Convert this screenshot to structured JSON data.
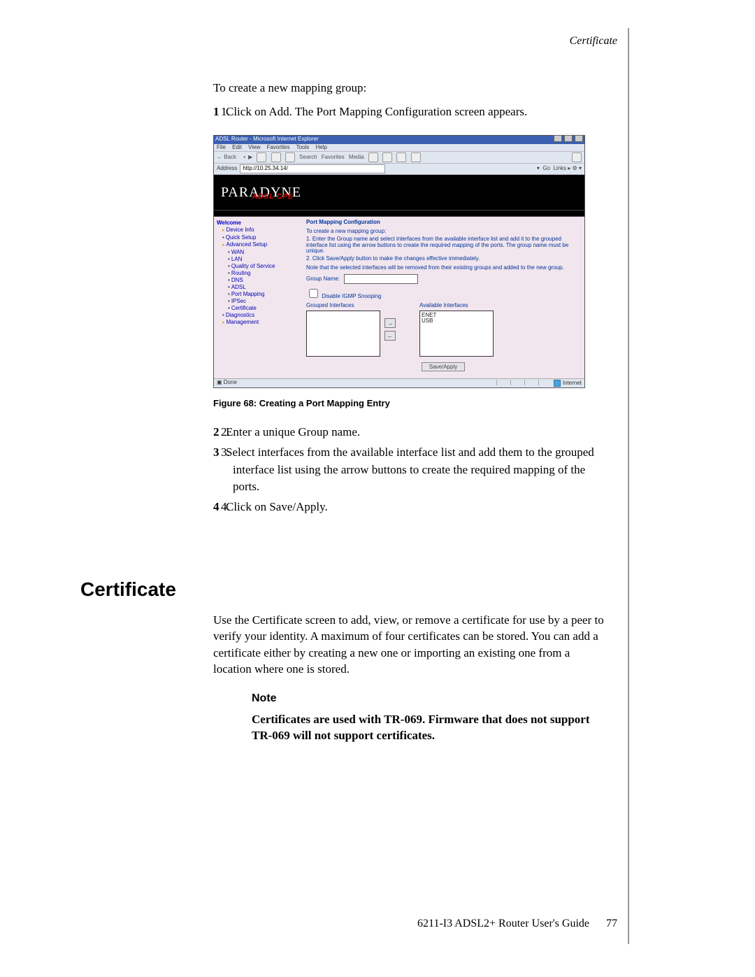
{
  "header": {
    "breadcrumb": "Certificate"
  },
  "intro": "To create a new mapping group:",
  "step1": "Click on Add. The Port Mapping Configuration screen appears.",
  "figure": {
    "caption": "Figure 68: Creating a Port Mapping Entry",
    "window_title": "ADSL Router - Microsoft Internet Explorer",
    "menu": {
      "file": "File",
      "edit": "Edit",
      "view": "View",
      "fav": "Favorites",
      "tools": "Tools",
      "help": "Help"
    },
    "toolbar": {
      "back": "Back",
      "search": "Search",
      "favorites": "Favorites",
      "media": "Media"
    },
    "address_label": "Address",
    "url": "http://10.25.34.14/",
    "go": "Go",
    "links": "Links",
    "brand": "PARADYNE",
    "brand_sub": "ADSL CPE",
    "sidebar": {
      "root": "Welcome",
      "device_info": "Device Info",
      "quick_setup": "Quick Setup",
      "advanced": "Advanced Setup",
      "wan": "WAN",
      "lan": "LAN",
      "qos": "Quality of Service",
      "routing": "Routing",
      "dns": "DNS",
      "adsl": "ADSL",
      "port_mapping": "Port Mapping",
      "ipsec": "IPSec",
      "certificate": "Certificate",
      "diagnostics": "Diagnostics",
      "management": "Management"
    },
    "panel": {
      "title": "Port Mapping Configuration",
      "pre": "To create a new mapping group:",
      "l1": "1. Enter the Group name and select interfaces from the available interface list and add it to the grouped interface list using the arrow buttons to create the required mapping of the ports. The group name must be unique.",
      "l2": "2. Click Save/Apply button to make the changes effective immediately.",
      "note": "Note that the selected interfaces will be removed from their existing groups and added to the new group.",
      "group_label": "Group Name:",
      "igmp": "Disable IGMP Snooping",
      "grouped_label": "Grouped Interfaces",
      "avail_label": "Available Interfaces",
      "avail1": "ENET",
      "avail2": "USB",
      "save": "Save/Apply",
      "status_done": "Done",
      "status_internet": "Internet"
    }
  },
  "step2": "Enter a unique Group name.",
  "step3": "Select interfaces from the available interface list and add them to the grouped interface list using the arrow buttons to create the required mapping of the ports.",
  "step4": "Click on Save/Apply.",
  "section_heading": "Certificate",
  "section_body": "Use the Certificate screen to add, view, or remove a certificate for use by a peer to verify your identity. A maximum of four certificates can be stored. You can add a certificate either by creating a new one or importing an existing one from a location where one is stored.",
  "note_heading": "Note",
  "note_body": "Certificates are used with TR-069. Firmware that does not support TR-069 will not support certificates.",
  "footer_guide": "6211-I3 ADSL2+ Router User's Guide",
  "footer_page": "77"
}
